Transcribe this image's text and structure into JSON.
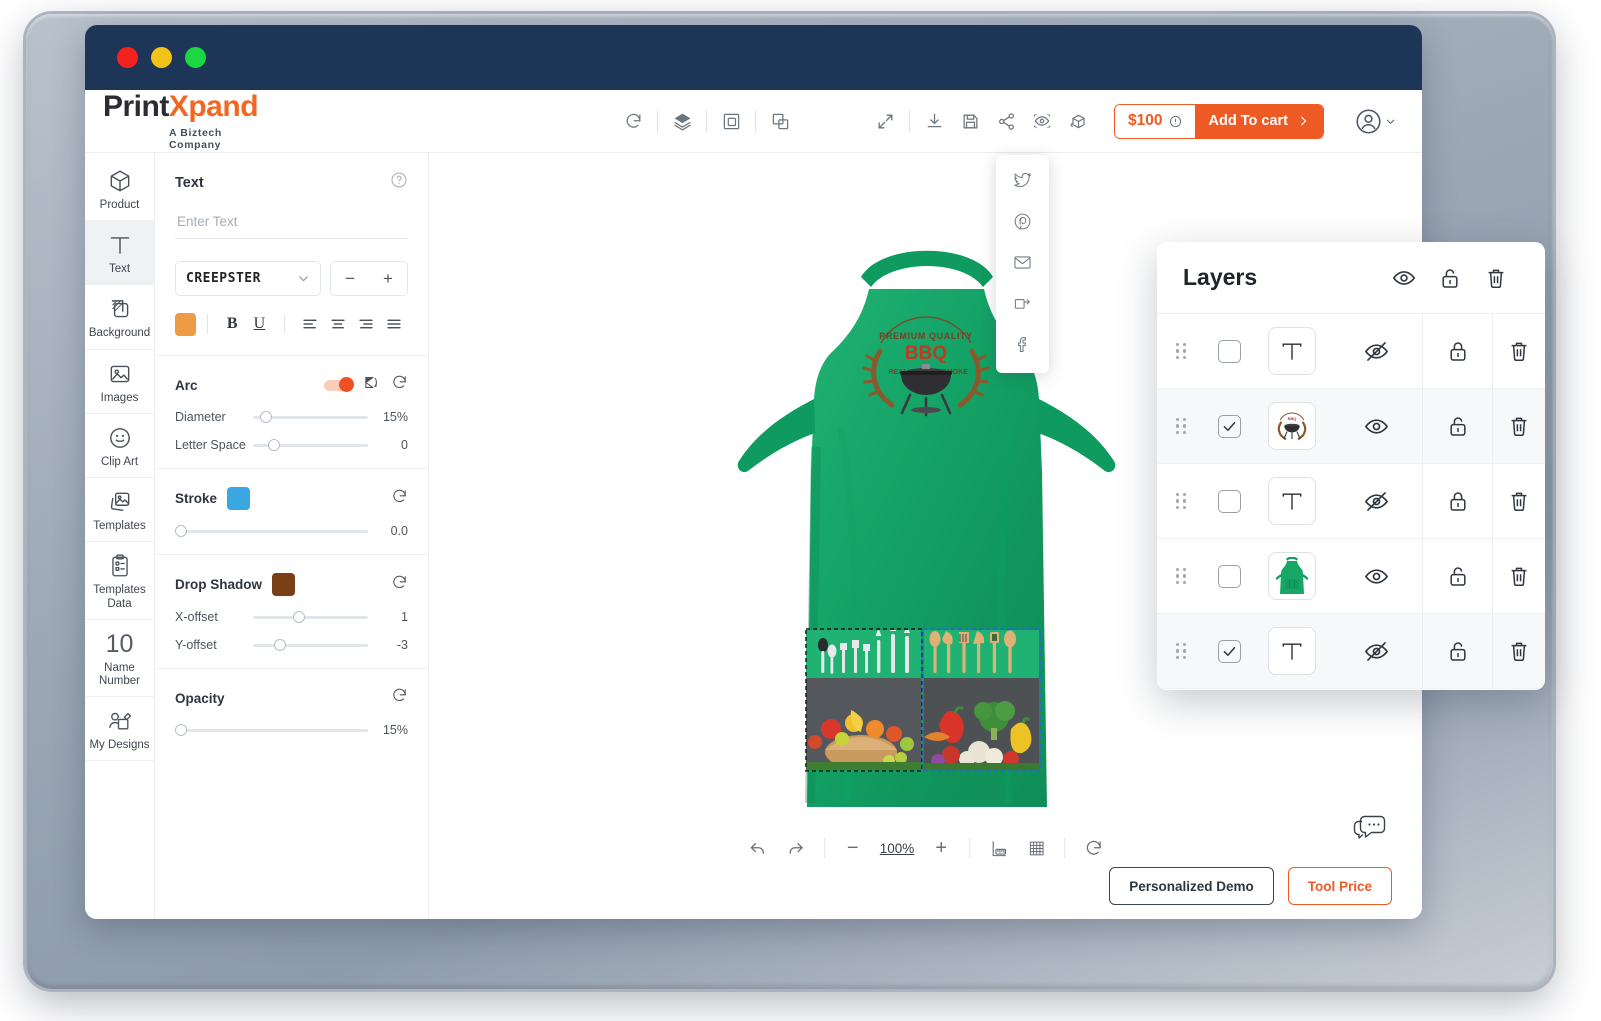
{
  "window": {
    "traffic_lights": [
      "close",
      "minimize",
      "maximize"
    ]
  },
  "brand": {
    "name_part1": "Print",
    "name_part2": "X",
    "name_part3": "pand",
    "tagline": "A Biztech Company"
  },
  "header": {
    "center_tools": [
      {
        "name": "reset-history-icon",
        "label": "Reset"
      },
      {
        "name": "layers-icon",
        "label": "Layers"
      },
      {
        "name": "group-icon",
        "label": "Group"
      },
      {
        "name": "duplicate-icon",
        "label": "Duplicate"
      }
    ],
    "right_tools": [
      {
        "name": "fullscreen-icon",
        "label": "Fullscreen"
      },
      {
        "name": "download-icon",
        "label": "Download"
      },
      {
        "name": "save-icon",
        "label": "Save"
      },
      {
        "name": "share-icon",
        "label": "Share"
      },
      {
        "name": "preview-icon",
        "label": "Preview"
      },
      {
        "name": "view-3d-icon",
        "label": "3D View"
      }
    ],
    "price": "$100",
    "add_to_cart": "Add To cart",
    "account_label": "Account"
  },
  "share_menu": {
    "items": [
      {
        "name": "twitter-icon",
        "label": "Twitter"
      },
      {
        "name": "pinterest-icon",
        "label": "Pinterest"
      },
      {
        "name": "email-icon",
        "label": "Email"
      },
      {
        "name": "copy-link-icon",
        "label": "Copy Link"
      },
      {
        "name": "facebook-icon",
        "label": "Facebook"
      }
    ]
  },
  "sidebar": {
    "items": [
      {
        "label": "Product",
        "icon": "cube-icon",
        "active": false
      },
      {
        "label": "Text",
        "icon": "text-icon",
        "active": true
      },
      {
        "label": "Background",
        "icon": "background-icon",
        "active": false
      },
      {
        "label": "Images",
        "icon": "image-icon",
        "active": false
      },
      {
        "label": "Clip Art",
        "icon": "smiley-icon",
        "active": false
      },
      {
        "label": "Templates",
        "icon": "templates-icon",
        "active": false
      },
      {
        "label": "Templates Data",
        "icon": "clipboard-icon",
        "active": false
      },
      {
        "label": "Name Number",
        "icon": "number-10-icon",
        "value": "10",
        "active": false
      },
      {
        "label": "My Designs",
        "icon": "my-designs-icon",
        "active": false
      }
    ]
  },
  "properties": {
    "panel_title": "Text",
    "help_icon": "question-mark-icon",
    "text_input_value": "",
    "text_input_placeholder": "Enter Text",
    "font_family": "CREEPSTER",
    "font_size_decrease": "−",
    "font_size_increase": "+",
    "text_color": "#ED9C45",
    "bold_label": "B",
    "underline_label": "U",
    "align_options": [
      "align-left",
      "align-center",
      "align-right",
      "align-justify"
    ],
    "arc": {
      "title": "Arc",
      "enabled": true,
      "flip_icon": "flip-icon",
      "reset_icon": "reset-icon",
      "diameter_label": "Diameter",
      "diameter_value": "15%",
      "diameter_pct": 6,
      "letter_space_label": "Letter Space",
      "letter_space_value": "0",
      "letter_space_pct": 11
    },
    "stroke": {
      "title": "Stroke",
      "color": "#3BA7E0",
      "reset_icon": "reset-icon",
      "value": "0.0",
      "pct": 0
    },
    "drop_shadow": {
      "title": "Drop Shadow",
      "color": "#7B3F16",
      "reset_icon": "reset-icon",
      "x_label": "X-offset",
      "x_value": "1",
      "x_pct": 35,
      "y_label": "Y-offset",
      "y_value": "-3",
      "y_pct": 18
    },
    "opacity": {
      "title": "Opacity",
      "reset_icon": "reset-icon",
      "value": "15%",
      "pct": 0
    }
  },
  "canvas": {
    "product": "green-apron",
    "product_color": "#17A866",
    "logo_text_top": "PREMIUM QUALITY",
    "logo_text_main": "BBQ",
    "logo_text_left": "REAL",
    "logo_text_right": "SMOKE",
    "selection_left_color": "#16181b",
    "selection_right_color": "#2f5fe0"
  },
  "zoom_bar": {
    "undo_icon": "undo-icon",
    "redo_icon": "redo-icon",
    "zoom_out": "−",
    "zoom_level": "100%",
    "zoom_in": "+",
    "ruler_icon": "ruler-icon",
    "grid_icon": "grid-icon",
    "reset_icon": "reset-icon"
  },
  "footer": {
    "chat_icon": "chat-icon",
    "personalized_demo": "Personalized Demo",
    "tool_price": "Tool Price"
  },
  "layers": {
    "title": "Layers",
    "header_icons": [
      {
        "name": "eye-icon",
        "label": "Toggle all visibility"
      },
      {
        "name": "unlock-icon",
        "label": "Toggle all locks"
      },
      {
        "name": "trash-icon",
        "label": "Delete all"
      }
    ],
    "rows": [
      {
        "type": "text",
        "checked": false,
        "visible": false,
        "locked": true,
        "alt": false
      },
      {
        "type": "logo",
        "checked": true,
        "visible": true,
        "locked": false,
        "alt": true
      },
      {
        "type": "text",
        "checked": false,
        "visible": false,
        "locked": true,
        "alt": false
      },
      {
        "type": "apron",
        "checked": false,
        "visible": true,
        "locked": false,
        "alt": false
      },
      {
        "type": "text",
        "checked": true,
        "visible": false,
        "locked": false,
        "alt": true
      }
    ]
  }
}
